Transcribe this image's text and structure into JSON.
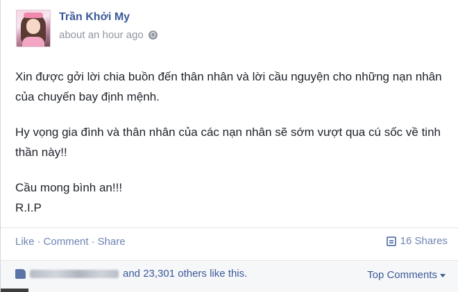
{
  "post": {
    "author": "Trần Khởi My",
    "timestamp": "about an hour ago",
    "privacy_icon": "globe-icon",
    "paragraphs": [
      "Xin được gởi lời chia buồn đến thân nhân và lời cầu nguyện cho những nạn nhân của chuyến bay định mệnh.",
      "Hy vọng gia đình và thân nhân của các nạn nhân sẽ sớm vượt qua cú sốc về tinh thần này!!",
      "Cầu mong bình an!!!",
      "R.I.P"
    ]
  },
  "actions": {
    "like": "Like",
    "comment": "Comment",
    "share": "Share",
    "separator": "·",
    "shares_count": "16 Shares"
  },
  "likes": {
    "others_text": "and 23,301 others like this.",
    "top_comments": "Top Comments"
  },
  "colors": {
    "link": "#3b5998",
    "action": "#6d84b4",
    "muted": "#9197a3",
    "likes_bg": "#f6f7f9"
  }
}
